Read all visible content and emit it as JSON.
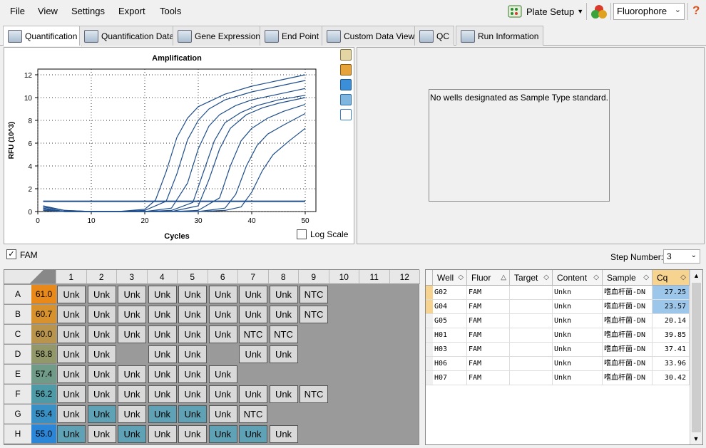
{
  "menu": {
    "items": [
      "File",
      "View",
      "Settings",
      "Export",
      "Tools"
    ]
  },
  "toolbar": {
    "plate_setup_label": "Plate Setup",
    "fluorophore_value": "Fluorophore",
    "help_label": "?"
  },
  "tabs": [
    {
      "label": "Quantification",
      "icon": "amplification-icon",
      "active": true
    },
    {
      "label": "Quantification Data",
      "icon": "data-sheet-icon",
      "active": false
    },
    {
      "label": "Gene Expression",
      "icon": "bar-chart-icon",
      "active": false
    },
    {
      "label": "End Point",
      "icon": "end-point-icon",
      "active": false
    },
    {
      "label": "Custom Data View",
      "icon": "gear-icon",
      "active": false
    },
    {
      "label": "QC",
      "icon": "qc-check-icon",
      "active": false
    },
    {
      "label": "Run Information",
      "icon": "info-sheet-icon",
      "active": false
    }
  ],
  "chart_data": {
    "type": "line",
    "title": "Amplification",
    "xlabel": "Cycles",
    "ylabel": "RFU (10^3)",
    "xlim": [
      0,
      52
    ],
    "ylim": [
      0,
      12.5
    ],
    "xticks": [
      0,
      10,
      20,
      30,
      40,
      50
    ],
    "yticks": [
      0,
      2,
      4,
      6,
      8,
      10,
      12
    ],
    "grid": true,
    "series": [
      {
        "x": [
          1,
          5,
          10,
          15,
          20,
          22,
          24,
          26,
          28,
          30,
          35,
          40,
          45,
          50
        ],
        "y": [
          0.4,
          0.1,
          0.0,
          0.0,
          0.2,
          1.0,
          3.5,
          6.5,
          8.2,
          9.2,
          10.3,
          11.0,
          11.5,
          12.0
        ]
      },
      {
        "x": [
          1,
          5,
          10,
          15,
          20,
          24,
          26,
          28,
          30,
          32,
          35,
          40,
          45,
          50
        ],
        "y": [
          0.5,
          0.1,
          0.0,
          0.0,
          0.1,
          0.9,
          3.3,
          6.3,
          8.0,
          9.0,
          9.8,
          10.5,
          11.0,
          11.5
        ]
      },
      {
        "x": [
          1,
          5,
          10,
          15,
          20,
          25,
          28,
          30,
          32,
          34,
          37,
          40,
          45,
          50
        ],
        "y": [
          0.3,
          0.0,
          0.0,
          0.0,
          0.0,
          0.3,
          2.5,
          5.5,
          7.5,
          8.5,
          9.3,
          9.8,
          10.3,
          10.8
        ]
      },
      {
        "x": [
          1,
          5,
          10,
          15,
          20,
          25,
          29,
          31,
          33,
          35,
          38,
          41,
          45,
          50
        ],
        "y": [
          0.3,
          0.0,
          0.0,
          0.0,
          0.0,
          0.1,
          0.8,
          3.5,
          6.2,
          7.8,
          8.7,
          9.3,
          9.8,
          10.2
        ]
      },
      {
        "x": [
          1,
          5,
          10,
          15,
          20,
          25,
          30,
          32,
          34,
          36,
          39,
          42,
          45,
          50
        ],
        "y": [
          0.2,
          0.0,
          0.0,
          0.0,
          0.0,
          0.0,
          0.5,
          2.8,
          5.5,
          7.3,
          8.5,
          9.1,
          9.5,
          10.0
        ]
      },
      {
        "x": [
          1,
          5,
          10,
          15,
          20,
          25,
          30,
          34,
          36,
          38,
          40,
          43,
          46,
          50
        ],
        "y": [
          0.1,
          0.0,
          0.0,
          0.0,
          0.0,
          0.0,
          0.1,
          1.2,
          4.0,
          6.2,
          7.3,
          8.2,
          8.8,
          9.4
        ]
      },
      {
        "x": [
          1,
          5,
          10,
          15,
          20,
          25,
          30,
          35,
          37,
          39,
          41,
          43,
          46,
          50
        ],
        "y": [
          0.1,
          0.0,
          0.0,
          0.0,
          0.0,
          0.0,
          0.0,
          0.3,
          1.5,
          4.0,
          5.8,
          6.8,
          7.6,
          8.6
        ]
      },
      {
        "x": [
          1,
          5,
          10,
          15,
          20,
          25,
          30,
          35,
          38,
          40,
          42,
          44,
          47,
          50
        ],
        "y": [
          0.1,
          0.0,
          0.0,
          0.0,
          0.0,
          0.0,
          0.0,
          0.1,
          0.4,
          1.7,
          3.6,
          5.0,
          6.2,
          7.3
        ]
      },
      {
        "x": [
          1,
          50
        ],
        "y": [
          0.9,
          0.9
        ]
      }
    ]
  },
  "chart_options": {
    "log_scale_label": "Log Scale",
    "log_scale_checked": false
  },
  "side_icons": [
    "copy-icon",
    "export-chart-icon",
    "save-image-icon",
    "zoom-icon",
    "curve-icon"
  ],
  "standard_panel": {
    "message": "No wells designated as Sample Type standard."
  },
  "fluor_filter": {
    "label": "FAM",
    "checked": true
  },
  "step": {
    "label": "Step Number:",
    "value": "3"
  },
  "plate": {
    "columns": [
      "1",
      "2",
      "3",
      "4",
      "5",
      "6",
      "7",
      "8",
      "9",
      "10",
      "11",
      "12"
    ],
    "rows": [
      {
        "label": "A",
        "temp": "61.0",
        "temp_color": "#e8891a",
        "wells": [
          "Unk",
          "Unk",
          "Unk",
          "Unk",
          "Unk",
          "Unk",
          "Unk",
          "Unk",
          "NTC",
          "",
          "",
          ""
        ],
        "hl": [
          0,
          0,
          0,
          0,
          0,
          0,
          0,
          0,
          0,
          0,
          0,
          0
        ]
      },
      {
        "label": "B",
        "temp": "60.7",
        "temp_color": "#d7922e",
        "wells": [
          "Unk",
          "Unk",
          "Unk",
          "Unk",
          "Unk",
          "Unk",
          "Unk",
          "Unk",
          "NTC",
          "",
          "",
          ""
        ],
        "hl": [
          0,
          0,
          0,
          0,
          0,
          0,
          0,
          0,
          0,
          0,
          0,
          0
        ]
      },
      {
        "label": "C",
        "temp": "60.0",
        "temp_color": "#b8944d",
        "wells": [
          "Unk",
          "Unk",
          "Unk",
          "Unk",
          "Unk",
          "Unk",
          "NTC",
          "NTC",
          "",
          "",
          "",
          ""
        ],
        "hl": [
          0,
          0,
          0,
          0,
          0,
          0,
          0,
          0,
          0,
          0,
          0,
          0
        ]
      },
      {
        "label": "D",
        "temp": "58.8",
        "temp_color": "#93986a",
        "wells": [
          "Unk",
          "Unk",
          "",
          "Unk",
          "Unk",
          "",
          "Unk",
          "Unk",
          "",
          "",
          "",
          ""
        ],
        "hl": [
          0,
          0,
          0,
          0,
          0,
          0,
          0,
          0,
          0,
          0,
          0,
          0
        ]
      },
      {
        "label": "E",
        "temp": "57.4",
        "temp_color": "#6f9b88",
        "wells": [
          "Unk",
          "Unk",
          "Unk",
          "Unk",
          "Unk",
          "Unk",
          "",
          "",
          "",
          "",
          "",
          ""
        ],
        "hl": [
          0,
          0,
          0,
          0,
          0,
          0,
          0,
          0,
          0,
          0,
          0,
          0
        ]
      },
      {
        "label": "F",
        "temp": "56.2",
        "temp_color": "#4e9aa6",
        "wells": [
          "Unk",
          "Unk",
          "Unk",
          "Unk",
          "Unk",
          "Unk",
          "Unk",
          "Unk",
          "NTC",
          "",
          "",
          ""
        ],
        "hl": [
          0,
          0,
          0,
          0,
          0,
          0,
          0,
          0,
          0,
          0,
          0,
          0
        ]
      },
      {
        "label": "G",
        "temp": "55.4",
        "temp_color": "#3890c4",
        "wells": [
          "Unk",
          "Unk",
          "Unk",
          "Unk",
          "Unk",
          "Unk",
          "NTC",
          "",
          "",
          "",
          "",
          ""
        ],
        "hl": [
          0,
          1,
          0,
          1,
          1,
          0,
          0,
          0,
          0,
          0,
          0,
          0
        ]
      },
      {
        "label": "H",
        "temp": "55.0",
        "temp_color": "#2b86d8",
        "wells": [
          "Unk",
          "Unk",
          "Unk",
          "Unk",
          "Unk",
          "Unk",
          "Unk",
          "Unk",
          "",
          "",
          "",
          ""
        ],
        "hl": [
          1,
          0,
          1,
          0,
          0,
          1,
          1,
          0,
          0,
          0,
          0,
          0
        ]
      }
    ]
  },
  "results_table": {
    "columns": [
      "Well",
      "Fluor",
      "Target",
      "Content",
      "Sample",
      "Cq"
    ],
    "rows": [
      {
        "well": "G02",
        "fluor": "FAM",
        "target": "",
        "content": "Unkn",
        "sample": "嗜血杆菌-DN",
        "cq": "27.25",
        "hl": true
      },
      {
        "well": "G04",
        "fluor": "FAM",
        "target": "",
        "content": "Unkn",
        "sample": "嗜血杆菌-DN",
        "cq": "23.57",
        "hl": true
      },
      {
        "well": "G05",
        "fluor": "FAM",
        "target": "",
        "content": "Unkn",
        "sample": "嗜血杆菌-DN",
        "cq": "20.14",
        "hl": false
      },
      {
        "well": "H01",
        "fluor": "FAM",
        "target": "",
        "content": "Unkn",
        "sample": "嗜血杆菌-DN",
        "cq": "39.85",
        "hl": false
      },
      {
        "well": "H03",
        "fluor": "FAM",
        "target": "",
        "content": "Unkn",
        "sample": "嗜血杆菌-DN",
        "cq": "37.41",
        "hl": false
      },
      {
        "well": "H06",
        "fluor": "FAM",
        "target": "",
        "content": "Unkn",
        "sample": "嗜血杆菌-DN",
        "cq": "33.96",
        "hl": false
      },
      {
        "well": "H07",
        "fluor": "FAM",
        "target": "",
        "content": "Unkn",
        "sample": "嗜血杆菌-DN",
        "cq": "30.42",
        "hl": false
      }
    ]
  },
  "colors": {
    "curve": "#1f4e8c",
    "unk_well": "#d9d9d9",
    "highlight_well": "#5fa2b5",
    "plate_bg": "#9a9a9a",
    "cq_highlight": "#9cc6ea"
  }
}
